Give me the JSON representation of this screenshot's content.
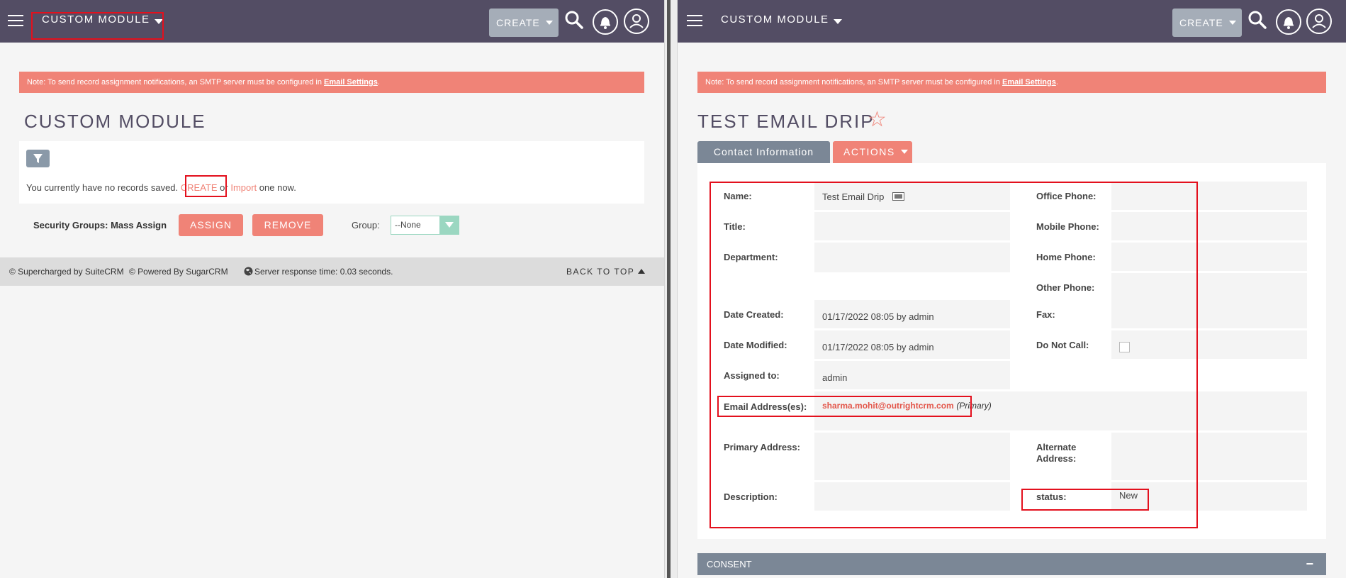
{
  "left": {
    "topbar": {
      "module_title": "CUSTOM MODULE",
      "create_label": "CREATE"
    },
    "note": {
      "text": "Note: To send record assignment notifications, an SMTP server must be configured in ",
      "link": "Email Settings",
      "end": "."
    },
    "page_title": "CUSTOM MODULE",
    "empty": {
      "prefix": "You currently have no records saved. ",
      "create": "CREATE",
      "or": " or ",
      "import": "Import",
      "suffix": " one now."
    },
    "security": {
      "label": "Security Groups: Mass Assign",
      "assign": "ASSIGN",
      "remove": "REMOVE",
      "group_label": "Group:",
      "group_value": "--None"
    },
    "footer": {
      "suitecrm": "© Supercharged by SuiteCRM",
      "sugarcrm": "© Powered By SugarCRM",
      "response": "Server response time: 0.03 seconds.",
      "back_to_top": "BACK TO TOP"
    }
  },
  "right": {
    "topbar": {
      "module_title": "CUSTOM MODULE",
      "create_label": "CREATE"
    },
    "note": {
      "text": "Note: To send record assignment notifications, an SMTP server must be configured in ",
      "link": "Email Settings",
      "end": "."
    },
    "record_title": "TEST EMAIL DRIP",
    "tabs": {
      "contact": "Contact Information",
      "actions": "ACTIONS"
    },
    "fields": {
      "name": {
        "label": "Name:",
        "value": "Test Email Drip"
      },
      "title": {
        "label": "Title:",
        "value": ""
      },
      "department": {
        "label": "Department:",
        "value": ""
      },
      "date_created": {
        "label": "Date Created:",
        "value": "01/17/2022 08:05 by admin"
      },
      "date_modified": {
        "label": "Date Modified:",
        "value": "01/17/2022 08:05 by admin"
      },
      "assigned_to": {
        "label": "Assigned to:",
        "value": "admin"
      },
      "email": {
        "label": "Email Address(es):",
        "value": "sharma.mohit@outrightcrm.com",
        "tag": "(Primary)"
      },
      "primary_address": {
        "label": "Primary Address:",
        "value": ""
      },
      "description": {
        "label": "Description:",
        "value": ""
      },
      "office_phone": {
        "label": "Office Phone:",
        "value": ""
      },
      "mobile_phone": {
        "label": "Mobile Phone:",
        "value": ""
      },
      "home_phone": {
        "label": "Home Phone:",
        "value": ""
      },
      "other_phone": {
        "label": "Other Phone:",
        "value": ""
      },
      "fax": {
        "label": "Fax:",
        "value": ""
      },
      "do_not_call": {
        "label": "Do Not Call:",
        "checked": false
      },
      "alternate_address": {
        "label_1": "Alternate",
        "label_2": "Address:",
        "value": ""
      },
      "status": {
        "label": "status:",
        "value": "New"
      }
    },
    "consent": {
      "label": "CONSENT",
      "toggle": "−"
    }
  },
  "colors": {
    "header": "#534d64",
    "accent": "#f08377",
    "highlight": "#e3101d",
    "tab": "#7b8796"
  }
}
